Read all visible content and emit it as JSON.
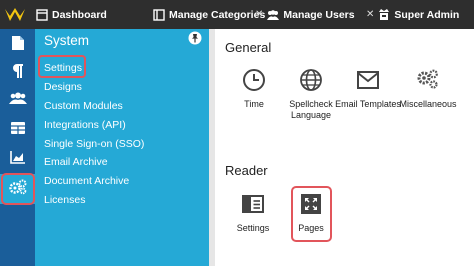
{
  "topbar": {
    "tabs": [
      {
        "label": "Dashboard",
        "icon": "dashboard-icon"
      },
      {
        "label": "Manage Categories",
        "icon": "categories-icon"
      },
      {
        "label": "Manage Users",
        "icon": "users-icon"
      },
      {
        "label": "Super Admin",
        "icon": "admin-icon"
      }
    ]
  },
  "rail": {
    "items": [
      "document-icon",
      "paragraph-icon",
      "users-icon",
      "table-icon",
      "chart-icon",
      "settings-cogs-icon"
    ]
  },
  "submenu": {
    "title": "System",
    "items": [
      "Settings",
      "Designs",
      "Custom Modules",
      "Integrations (API)",
      "Single Sign-on (SSO)",
      "Email Archive",
      "Document Archive",
      "Licenses"
    ]
  },
  "main": {
    "general_title": "General",
    "general_tiles": [
      {
        "label": "Time",
        "icon": "clock-icon"
      },
      {
        "label": "Spellcheck Language",
        "icon": "globe-icon"
      },
      {
        "label": "Email Templates",
        "icon": "envelope-icon"
      },
      {
        "label": "Miscellaneous",
        "icon": "cogs-icon"
      }
    ],
    "reader_title": "Reader",
    "reader_tiles": [
      {
        "label": "Settings",
        "icon": "reader-settings-icon"
      },
      {
        "label": "Pages",
        "icon": "pages-icon"
      }
    ]
  },
  "colors": {
    "topbar": "#2e2e2e",
    "rail": "#1a5e9a",
    "submenu": "#25a9d6",
    "highlight": "#e2555b",
    "logo": "#f2c511"
  }
}
